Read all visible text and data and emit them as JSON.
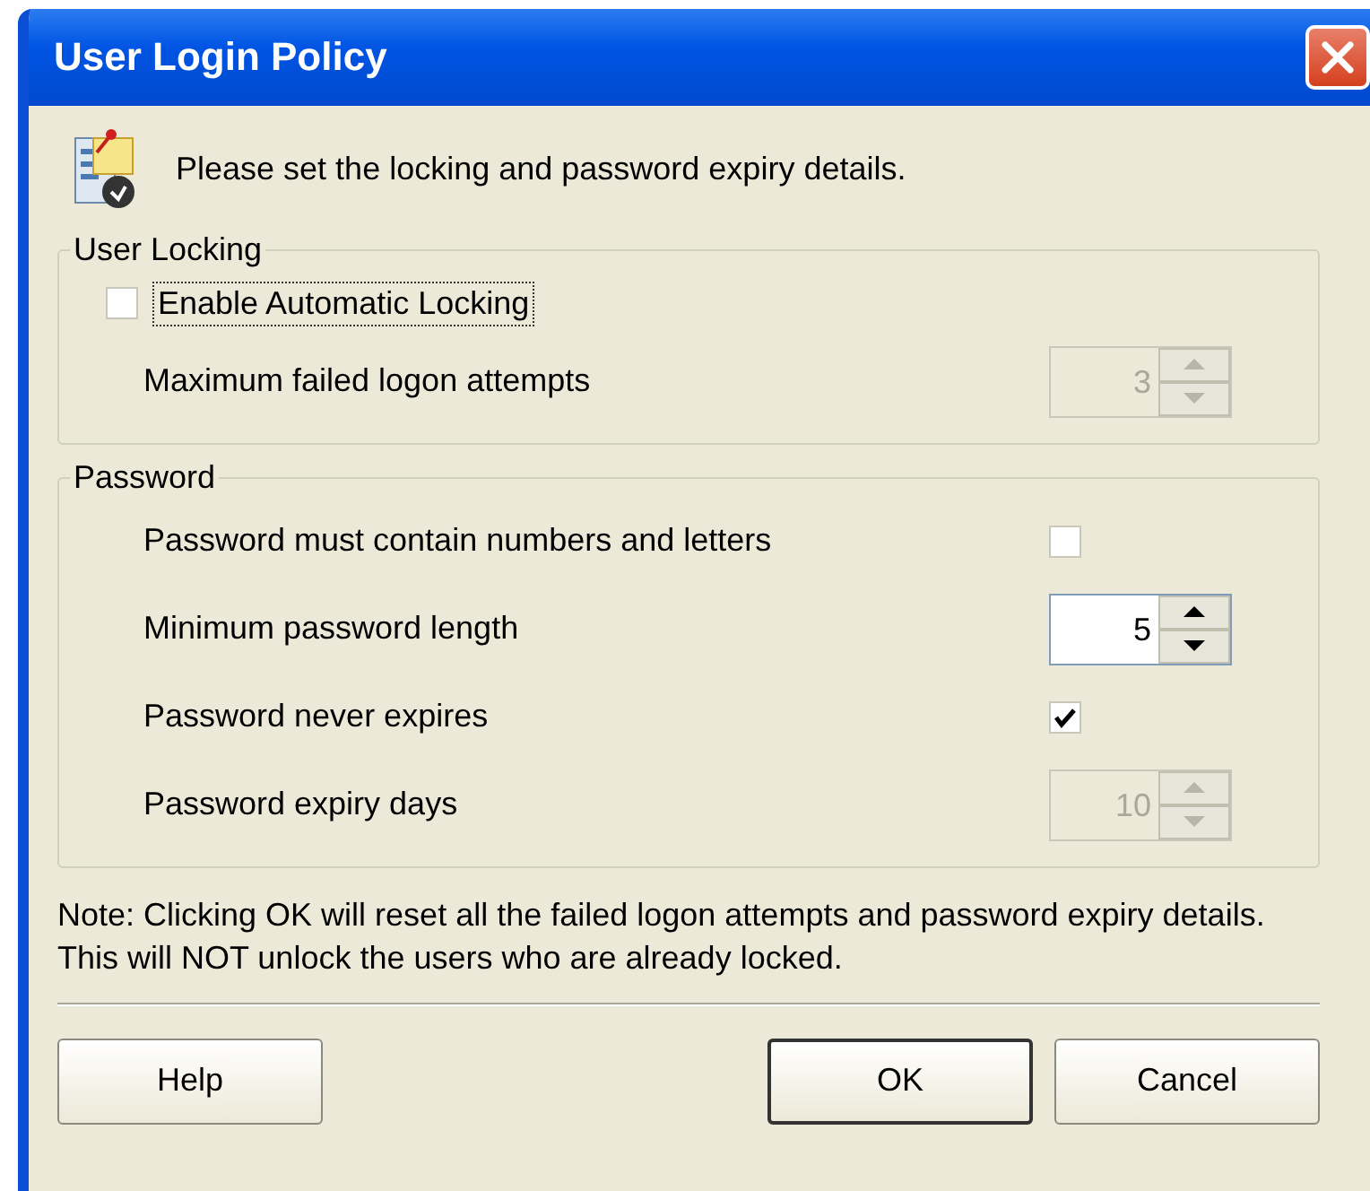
{
  "window": {
    "title": "User Login Policy"
  },
  "header": {
    "text": "Please set the locking and password expiry details."
  },
  "groups": [
    {
      "title": "User Locking",
      "rows": [
        {
          "kind": "leading-checkbox",
          "label": "Enable Automatic Locking",
          "checked": false,
          "focused": true
        },
        {
          "kind": "spinner",
          "label": "Maximum failed logon attempts",
          "value": "3",
          "disabled": true
        }
      ]
    },
    {
      "title": "Password",
      "rows": [
        {
          "kind": "checkbox",
          "label": "Password must contain numbers and letters",
          "checked": false
        },
        {
          "kind": "spinner",
          "label": "Minimum password length",
          "value": "5",
          "disabled": false
        },
        {
          "kind": "checkbox",
          "label": "Password never expires",
          "checked": true
        },
        {
          "kind": "spinner",
          "label": "Password expiry days",
          "value": "10",
          "disabled": true
        }
      ]
    }
  ],
  "note": "Note: Clicking OK will reset all the failed logon attempts and password expiry details. This will NOT unlock the users who are already locked.",
  "buttons": [
    {
      "label": "Help",
      "default": false
    },
    {
      "label": "OK",
      "default": true
    },
    {
      "label": "Cancel",
      "default": false
    }
  ]
}
